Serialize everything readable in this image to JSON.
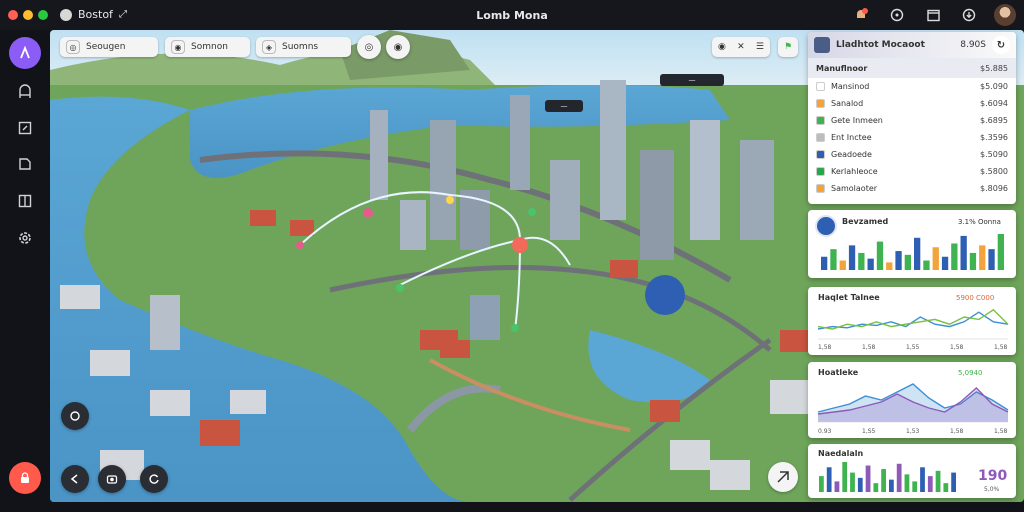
{
  "window": {
    "app_name": "Bostof",
    "title": "Lomb Mona",
    "dots": [
      "#ff5f57",
      "#febc2e",
      "#28c840"
    ]
  },
  "toolbar": {
    "icons": [
      "notification-icon",
      "help-icon",
      "window-icon",
      "download-icon",
      "user-avatar"
    ]
  },
  "sidebar": {
    "items": [
      "navigate-icon",
      "bookmark-icon",
      "edit-icon",
      "route-icon",
      "layers-icon",
      "settings-icon"
    ],
    "record_icon": "lock-icon"
  },
  "map_controls": {
    "chips": [
      {
        "label": "Seougen",
        "icon": "◎"
      },
      {
        "label": "Somnon",
        "icon": "◉"
      },
      {
        "label": "Suomns",
        "icon": "◈"
      }
    ],
    "compass_label": "◎",
    "target_label": "◉"
  },
  "map_labels": {
    "label_1": "—",
    "label_2": "—"
  },
  "bottom_controls": [
    "back-icon",
    "camera-icon",
    "refresh-icon"
  ],
  "accent": "#8b5cf6",
  "panel_list": {
    "header": {
      "title": "Lladhtot Mocaoot",
      "value": "8.90S"
    },
    "selected": {
      "label": "Manuflnoor",
      "value": "$5.885"
    },
    "rows": [
      {
        "label": "Mansinod",
        "value": "$5.090",
        "color": "#ffffff"
      },
      {
        "label": "Sanalod",
        "value": "$.6094",
        "color": "#f3a33b"
      },
      {
        "label": "Gete Inmeen",
        "value": "$.6895",
        "color": "#3fb34f"
      },
      {
        "label": "Ent Inctee",
        "value": "$.3596",
        "color": "#bdbdbd"
      },
      {
        "label": "Geadoede",
        "value": "$.5090",
        "color": "#2f5fb3"
      },
      {
        "label": "Kerlahleoce",
        "value": "$.5800",
        "color": "#2aa54a"
      },
      {
        "label": "Samolaoter",
        "value": "$.8096",
        "color": "#f3a33b"
      }
    ]
  },
  "chart_data": [
    {
      "type": "bar",
      "title": "Bevzamed",
      "value_label": "3.1% Oonna",
      "values": [
        14,
        22,
        10,
        26,
        18,
        12,
        30,
        8,
        20,
        16,
        34,
        10,
        24,
        14,
        28,
        36,
        18,
        26,
        22,
        38
      ],
      "colors": [
        "#2f5fb3",
        "#3fb34f",
        "#f3a33b",
        "#2f5fb3",
        "#3fb34f"
      ]
    },
    {
      "type": "line",
      "title": "Haqlet Talnee",
      "value_label": "5900 C000",
      "series": [
        {
          "values": [
            20,
            22,
            21,
            24,
            23,
            26,
            22,
            30,
            24,
            22,
            26,
            34,
            26,
            24
          ],
          "color": "#3b8fd4"
        },
        {
          "values": [
            22,
            20,
            24,
            22,
            26,
            22,
            24,
            26,
            28,
            24,
            30,
            28,
            36,
            24
          ],
          "color": "#7ac143"
        }
      ],
      "ticks": [
        "1,58",
        "1,58",
        "1,55",
        "1,58",
        "1,58"
      ]
    },
    {
      "type": "area",
      "title": "Hoatleke",
      "value_label": "5,0940",
      "series": [
        {
          "values": [
            10,
            14,
            18,
            26,
            22,
            30,
            38,
            24,
            14,
            18,
            30,
            22,
            12
          ],
          "color": "#3b8fd4"
        },
        {
          "values": [
            8,
            10,
            12,
            16,
            20,
            28,
            20,
            14,
            10,
            20,
            34,
            18,
            10
          ],
          "color": "#8e5ab8"
        }
      ],
      "ticks": [
        "0.93",
        "1,S5",
        "1,53",
        "1,58",
        "1,58"
      ]
    },
    {
      "type": "bar",
      "title": "Naedalaln",
      "value_label": "190",
      "value_unit": "5,0%",
      "values": [
        18,
        28,
        12,
        34,
        22,
        16,
        30,
        10,
        26,
        14,
        32,
        20,
        12,
        28,
        18,
        24,
        10,
        22
      ],
      "colors": [
        "#3fb34f",
        "#2f5fb3",
        "#8e5ab8",
        "#3fb34f"
      ]
    }
  ]
}
